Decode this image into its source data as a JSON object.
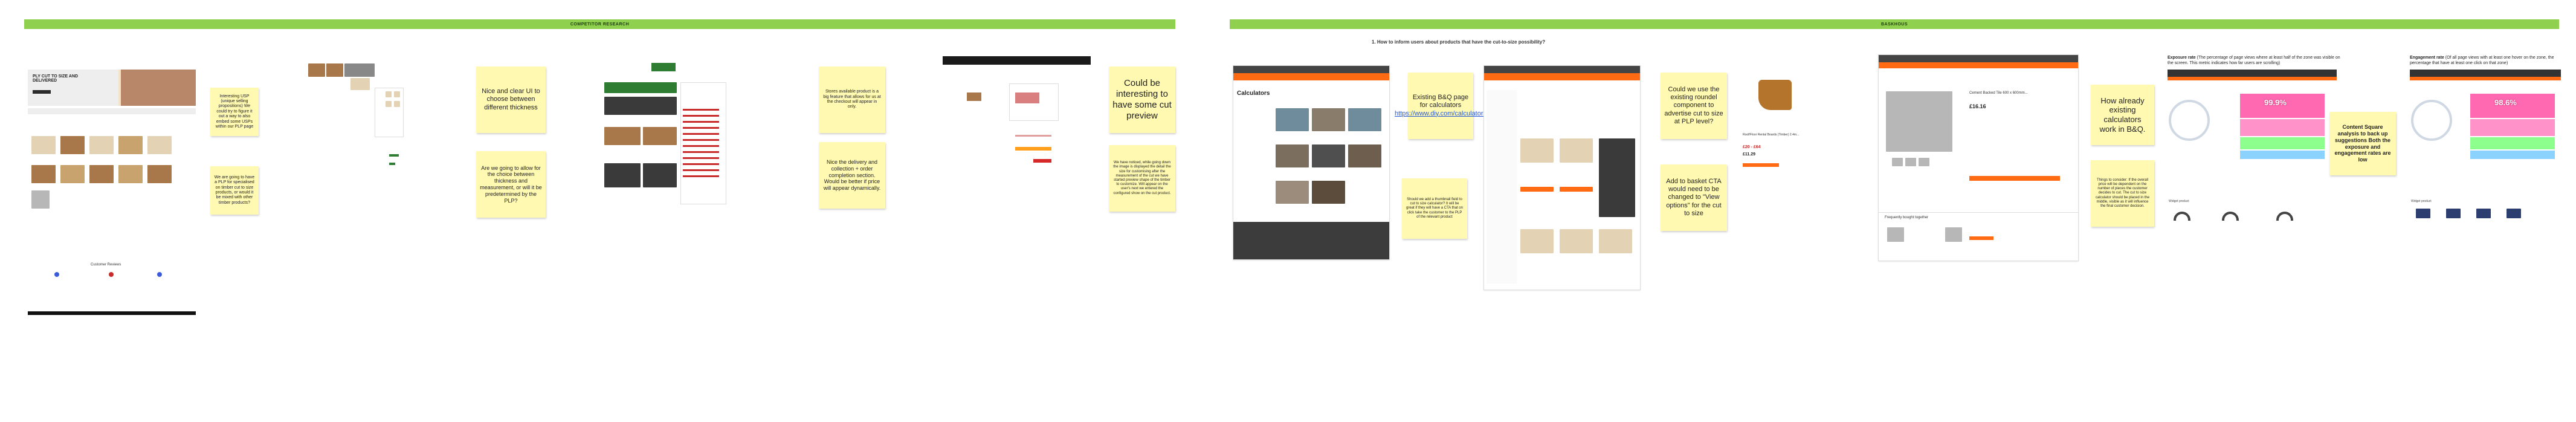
{
  "frames": [
    {
      "title": "COMPETITOR RESEARCH"
    },
    {
      "title": "BASKHOUS"
    }
  ],
  "question": "1. How to inform users about products that have the cut-to-size possibility?",
  "competitor_notes": [
    "Interesting USP (unique selling propositions) We could try to figure it out a way to also embed some USPs within our PLP page",
    "We are going to have a PLP for specialised on timber cut to size products, or would it be mixed with other timber products?",
    "Nice and clear UI to choose between different thickness",
    "Are we going to allow for the choice between thickness and measurement, or will it be predetermined by the PLP?",
    "Stores available product is a big feature that allows for us at the checkout will appear in only.",
    "Nice the delivery and collection + order completion section. Would be better if price will appear dynamically.",
    "Could be interesting to have some cut preview",
    "We have noticed, while going down the image is displayed the detail the size for customising after the measurement of the cut we have started preview shape of the timber to customize. Will appear on the user's next we entered the configured show on the cut product."
  ],
  "bq_notes": [
    "Existing B&Q page for calculators",
    "https://www.diy.com/calculators",
    "Should we add a thumbnail field to cut to size calculator? It will be great if they will have a CTA that on click take the customer to the PLP of the relevant product",
    "Could we use the existing roundel component to advertise cut to size at PLP level?",
    "Add to basket CTA would need to be changed to \"View options\" for the cut to size",
    "How already existing calculators work in B&Q.",
    "Things to consider: If the overall price will be dependent on the number of pieces the customer decides to cut. The cut to size calculator should be placed in the middle, visible as it will influence the final customer decision.",
    "Content Square analysis to back up suggestions Both the exposure and engagement rates are low"
  ],
  "metrics": [
    {
      "title": "Exposure rate",
      "desc": "(The percentage of page views where at least half of the zone was visible on the screen. This metric indicates how far users are scrolling)",
      "value": "99.9%"
    },
    {
      "title": "Engagement rate",
      "desc": "(Of all page views with at least one hover on the zone, the percentage that have at least one click on that zone)",
      "value": "98.6%"
    }
  ],
  "screens": {
    "offcut_headline": "PLY CUT TO SIZE AND DELIVERED",
    "customer_reviews": "Customer Reviews",
    "calc_title": "Calculators",
    "bq_product": "Roof/Floor Rental Boards (Timber) 2.4m...",
    "bq_price_1": "£20 - £64",
    "bq_price_2": "£11.29",
    "bq_tile_title": "Cement Backed Tile 600 x 600mm...",
    "bq_tile_price": "£16.16",
    "bq_related": "Frequently bought together",
    "widget_labels": [
      "Widget product",
      "Widget product"
    ]
  },
  "colors": {
    "frame_green": "#8fd14f",
    "sticky_yellow": "#fff9b1",
    "bq_orange": "#ff6a13",
    "heat_pink": "#ff4fa3"
  }
}
